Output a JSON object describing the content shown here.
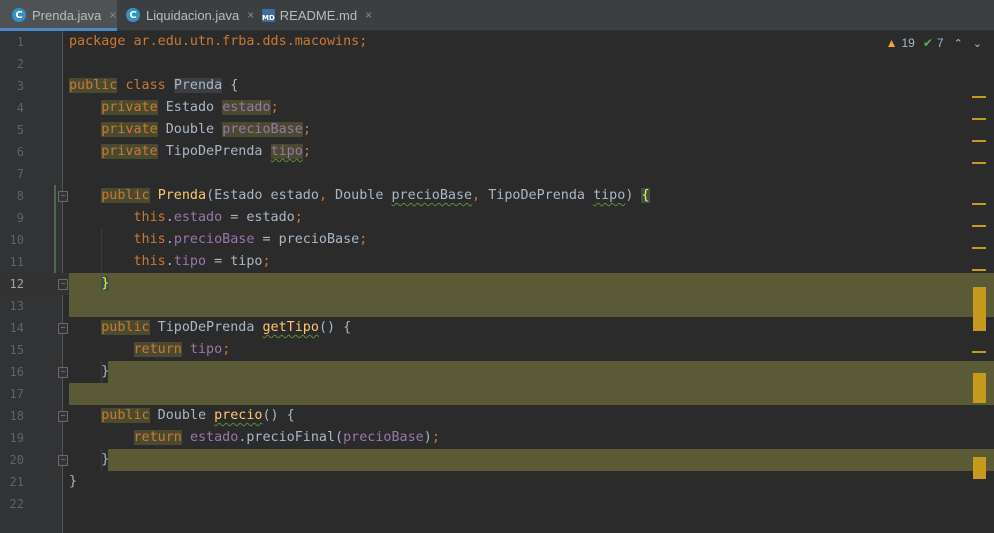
{
  "tabs": [
    {
      "label": "Prenda.java",
      "icon": "java-class-icon",
      "glyph": "C",
      "active": true
    },
    {
      "label": "Liquidacion.java",
      "icon": "java-class-icon",
      "glyph": "C",
      "active": false
    },
    {
      "label": "README.md",
      "icon": "markdown-file-icon",
      "glyph": "MD",
      "active": false
    }
  ],
  "close_glyph": "×",
  "inspections": {
    "warnings": "19",
    "typos": "7",
    "warning_glyph": "▲",
    "typo_glyph": "✔",
    "up_glyph": "⌃",
    "down_glyph": "⌄"
  },
  "fold_glyph": "−",
  "current_line": 12,
  "lines": [
    {
      "n": "1",
      "code": "package ar.edu.utn.frba.dds.macowins;"
    },
    {
      "n": "2",
      "code": ""
    },
    {
      "n": "3",
      "code": "public class Prenda {"
    },
    {
      "n": "4",
      "code": "    private Estado estado;"
    },
    {
      "n": "5",
      "code": "    private Double precioBase;"
    },
    {
      "n": "6",
      "code": "    private TipoDePrenda tipo;"
    },
    {
      "n": "7",
      "code": ""
    },
    {
      "n": "8",
      "code": "    public Prenda(Estado estado, Double precioBase, TipoDePrenda tipo) {"
    },
    {
      "n": "9",
      "code": "        this.estado = estado;"
    },
    {
      "n": "10",
      "code": "        this.precioBase = precioBase;"
    },
    {
      "n": "11",
      "code": "        this.tipo = tipo;"
    },
    {
      "n": "12",
      "code": "    }"
    },
    {
      "n": "13",
      "code": ""
    },
    {
      "n": "14",
      "code": "    public TipoDePrenda getTipo() {"
    },
    {
      "n": "15",
      "code": "        return tipo;"
    },
    {
      "n": "16",
      "code": "    }"
    },
    {
      "n": "17",
      "code": ""
    },
    {
      "n": "18",
      "code": "    public Double precio() {"
    },
    {
      "n": "19",
      "code": "        return estado.precioFinal(precioBase);"
    },
    {
      "n": "20",
      "code": "    }"
    },
    {
      "n": "21",
      "code": "}"
    },
    {
      "n": "22",
      "code": ""
    }
  ],
  "colors": {
    "background": "#2b2b2b",
    "keyword": "#cc7832",
    "field": "#9876aa",
    "method": "#ffc66d",
    "text": "#a9b7c6",
    "warning_highlight": "#5a5a37",
    "stripe_marker": "#c69a1e",
    "active_tab_underline": "#4a88c7"
  }
}
